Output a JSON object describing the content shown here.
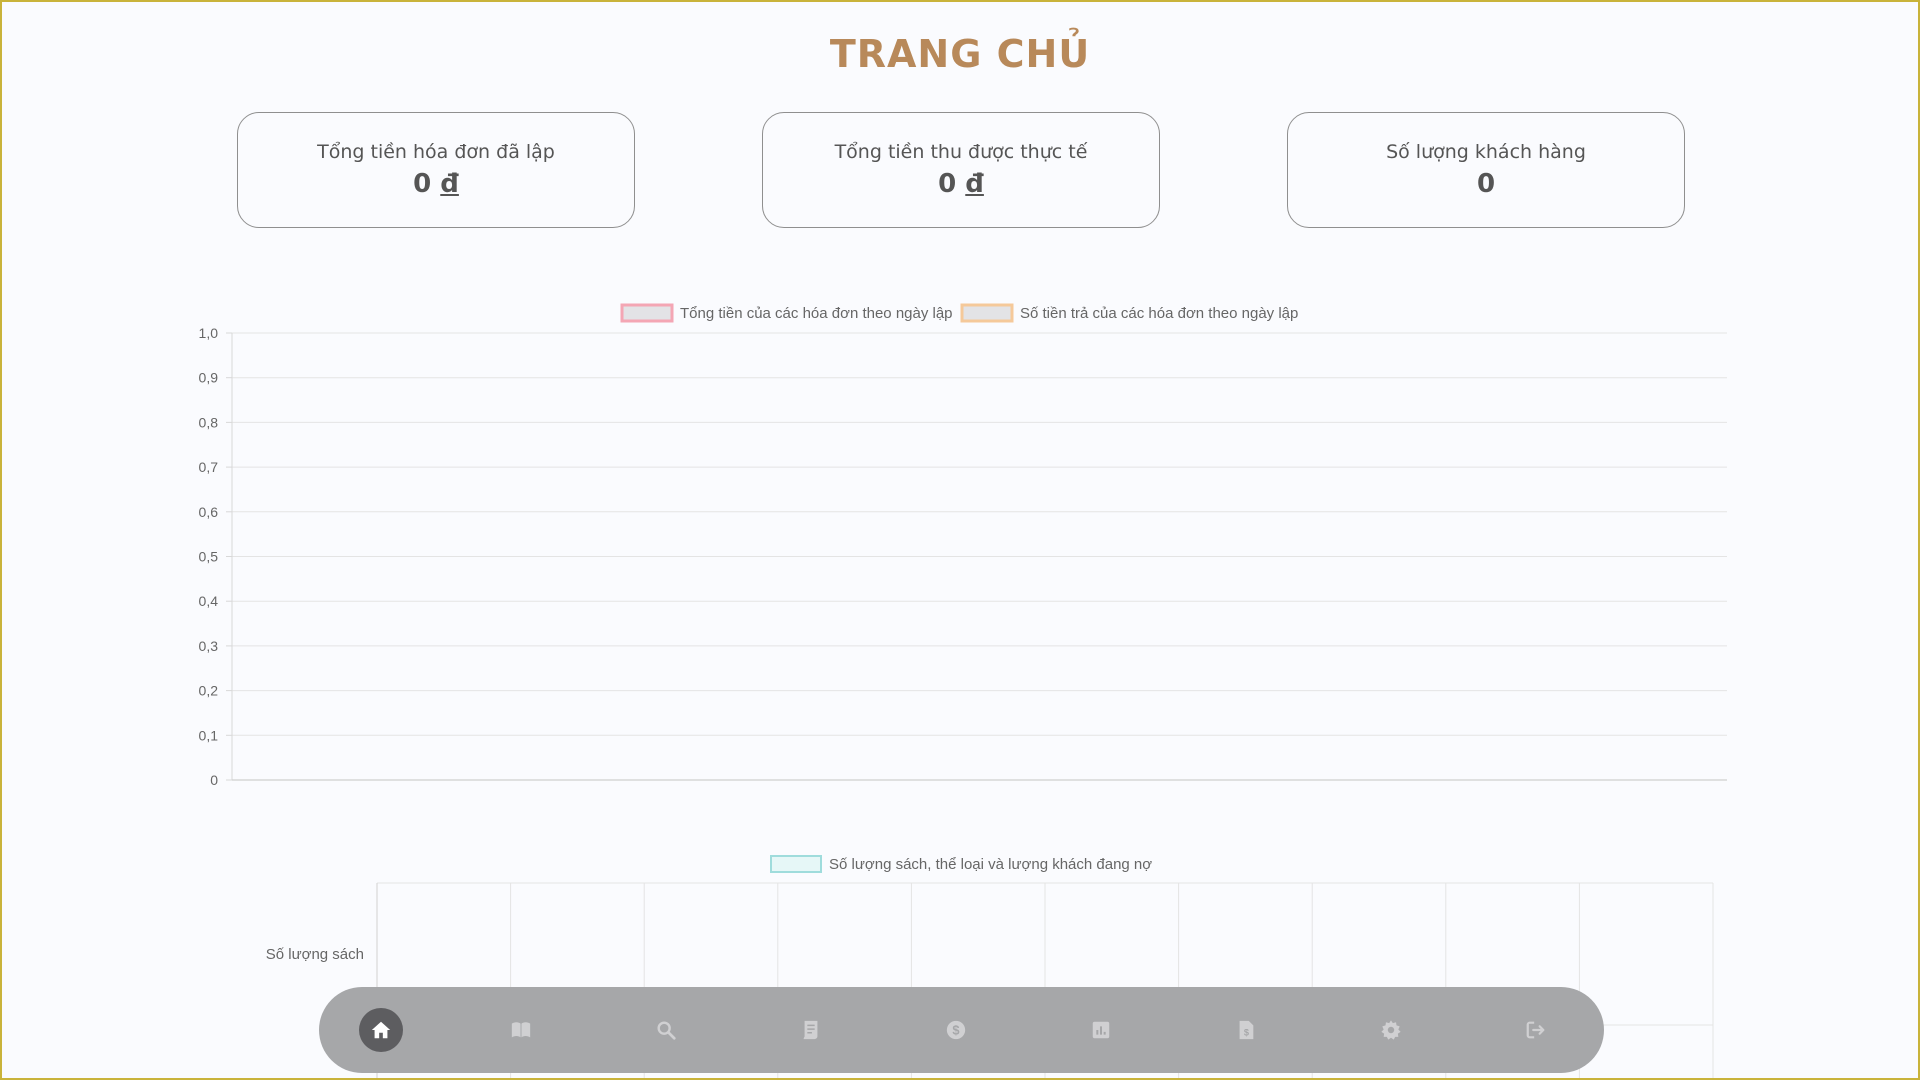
{
  "page": {
    "title": "TRANG CHỦ"
  },
  "stats": [
    {
      "label": "Tổng tiền hóa đơn đã lập",
      "value": "0",
      "currency": "đ"
    },
    {
      "label": "Tổng tiền thu được thực tế",
      "value": "0",
      "currency": "đ"
    },
    {
      "label": "Số lượng khách hàng",
      "value": "0"
    }
  ],
  "chart_data": [
    {
      "type": "line",
      "legend_position": "top",
      "series": [
        {
          "name": "Tổng tiền của các hóa đơn theo ngày lập",
          "values": [],
          "color": "#f4a6b4"
        },
        {
          "name": "Số tiền trả của các hóa đơn theo ngày lập",
          "values": [],
          "color": "#f5c99a"
        }
      ],
      "y_ticks": [
        "1,0",
        "0,9",
        "0,8",
        "0,7",
        "0,6",
        "0,5",
        "0,4",
        "0,3",
        "0,2",
        "0,1",
        "0"
      ],
      "ylim": [
        0,
        1
      ],
      "grid": true
    },
    {
      "type": "bar",
      "orientation": "horizontal",
      "legend_position": "top",
      "series": [
        {
          "name": "Số lượng sách, thể loại và lượng khách đang nợ",
          "values": [],
          "color": "#9fdcdc"
        }
      ],
      "categories": [
        "Số lượng sách"
      ],
      "grid": true
    }
  ],
  "navbar": {
    "items": [
      {
        "icon": "home-icon",
        "active": true
      },
      {
        "icon": "book-icon",
        "active": false
      },
      {
        "icon": "search-icon",
        "active": false
      },
      {
        "icon": "receipt-icon",
        "active": false
      },
      {
        "icon": "dollar-icon",
        "active": false
      },
      {
        "icon": "chart-icon",
        "active": false
      },
      {
        "icon": "invoice-icon",
        "active": false
      },
      {
        "icon": "gear-icon",
        "active": false
      },
      {
        "icon": "logout-icon",
        "active": false
      }
    ]
  },
  "colors": {
    "title": "#b8895a",
    "navbar_bg": "#a6a7a9",
    "nav_active": "#5d5d60",
    "nav_icon": "#d0d0d2"
  }
}
